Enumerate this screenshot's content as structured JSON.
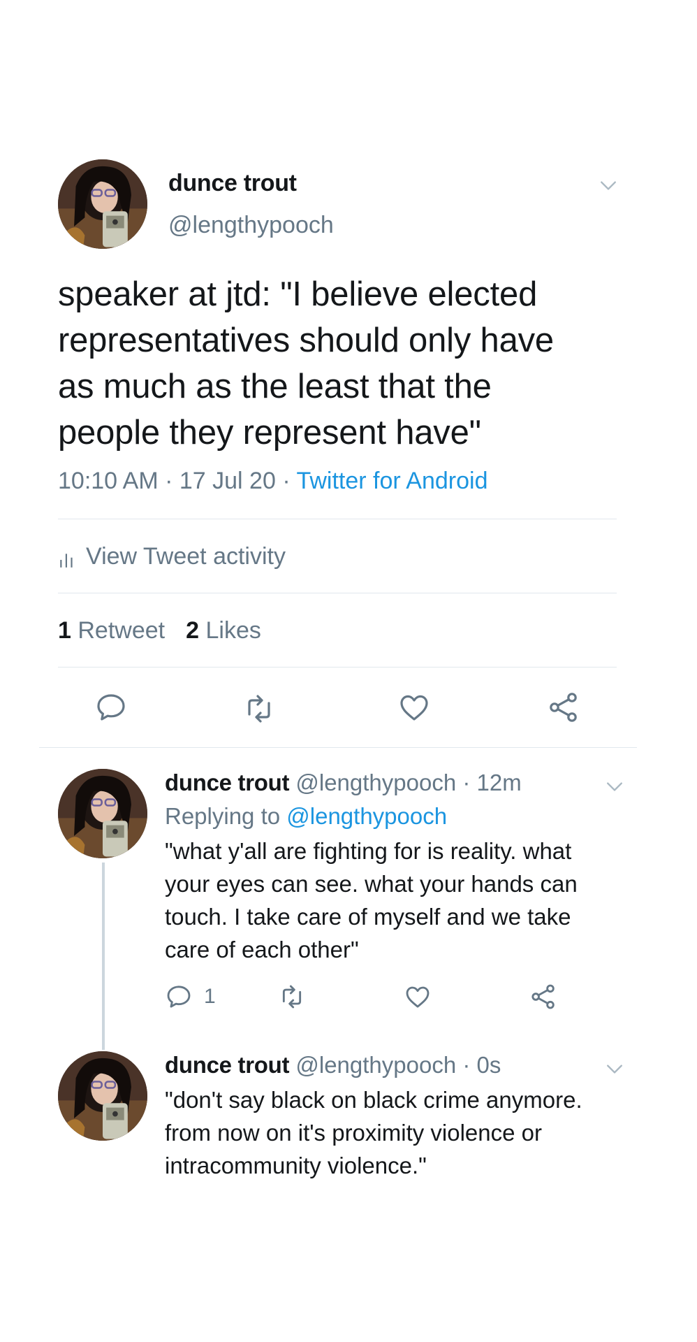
{
  "main_tweet": {
    "author_name": "dunce trout",
    "author_handle": "@lengthypooch",
    "text": "speaker at jtd: \"I believe elected\nrepresentatives should only have\nas much as the least that the\npeople they represent have\"",
    "time": "10:10 AM",
    "date": "17 Jul 20",
    "separator": " · ",
    "source": "Twitter for Android",
    "activity_label": "View Tweet activity",
    "retweet_count": "1",
    "retweet_label": "Retweet",
    "like_count": "2",
    "like_label": "Likes"
  },
  "replies": [
    {
      "author_name": "dunce trout",
      "author_handle": "@lengthypooch",
      "age": "12m",
      "replying_prefix": "Replying to ",
      "replying_to": "@lengthypooch",
      "text": "\"what y'all are fighting for is reality. what\nyour eyes can see. what your hands can\ntouch. I take care of myself and we take\ncare of each other\"",
      "reply_count": "1"
    },
    {
      "author_name": "dunce trout",
      "author_handle": "@lengthypooch",
      "age": "0s",
      "text": "\"don't say black on black crime anymore.\nfrom now on it's proximity violence or\nintracommunity violence.\""
    }
  ],
  "icons": {
    "reply": "speech-bubble-icon",
    "retweet": "retweet-arrows-icon",
    "like": "heart-icon",
    "share": "share-nodes-icon",
    "menu": "chevron-down-icon",
    "activity": "bar-chart-icon"
  },
  "colors": {
    "text_primary": "#14171a",
    "text_secondary": "#657786",
    "link": "#1b95e0",
    "divider": "#e1e8ed",
    "thread_line": "#ccd6dd"
  }
}
